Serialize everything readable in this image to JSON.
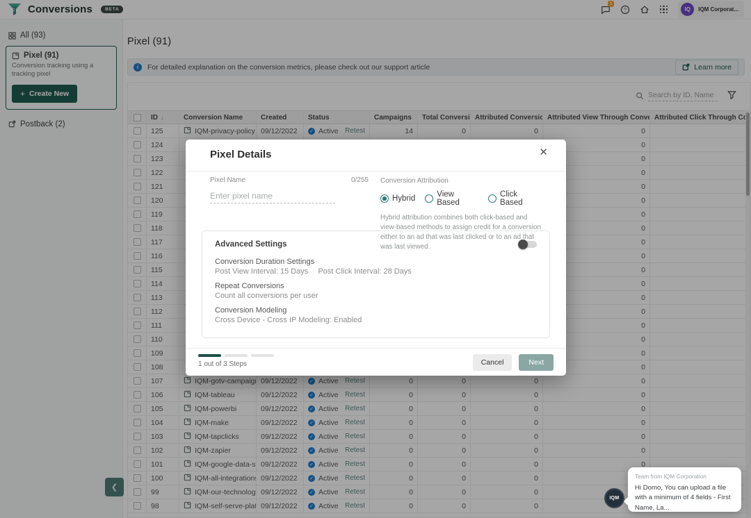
{
  "colors": {
    "accent_teal": "#1f5c52",
    "active_blue": "#1f7fd0",
    "avatar_purple": "#6d4bc4",
    "badge_orange": "#efa12d",
    "step_active": "#1d4f49"
  },
  "header": {
    "app_title": "Conversions",
    "beta_badge": "BETA",
    "notification_count": "1",
    "avatar_initials": "IQ",
    "account_name": "IQM Corporat..."
  },
  "sidebar": {
    "all_label": "All (93)",
    "pixel_card": {
      "title": "Pixel (91)",
      "description": "Conversion tracking using a tracking pixel",
      "create_label": "Create New",
      "plus": "+"
    },
    "postback_label": "Postback (2)"
  },
  "main": {
    "page_title": "Pixel (91)",
    "banner_text": "For detailed explanation on the conversion metrics, please check out our support article",
    "learn_more_label": "Learn more",
    "search_placeholder": "Search by ID, Name"
  },
  "table": {
    "columns": [
      "ID",
      "Conversion Name",
      "Created",
      "Status",
      "Campaigns",
      "Total Conversions",
      "Attributed Conversions",
      "Attributed View Through Conversions",
      "Attributed Click Through Conversions"
    ],
    "rows": [
      {
        "id": "125",
        "name": "IQM-privacy-policy",
        "created": "09/12/2022",
        "status": "Active",
        "action": "Retest",
        "campaigns": "14",
        "total": "0",
        "attributed": "0",
        "view_through": "0",
        "click_through": ""
      },
      {
        "id": "124",
        "name": "",
        "created": "",
        "status": "",
        "action": "",
        "campaigns": "",
        "total": "",
        "attributed": "",
        "view_through": "0",
        "click_through": ""
      },
      {
        "id": "123",
        "name": "",
        "created": "",
        "status": "",
        "action": "",
        "campaigns": "",
        "total": "",
        "attributed": "",
        "view_through": "0",
        "click_through": ""
      },
      {
        "id": "122",
        "name": "",
        "created": "",
        "status": "",
        "action": "",
        "campaigns": "",
        "total": "",
        "attributed": "",
        "view_through": "0",
        "click_through": ""
      },
      {
        "id": "121",
        "name": "",
        "created": "",
        "status": "",
        "action": "",
        "campaigns": "",
        "total": "",
        "attributed": "",
        "view_through": "0",
        "click_through": ""
      },
      {
        "id": "120",
        "name": "",
        "created": "",
        "status": "",
        "action": "",
        "campaigns": "",
        "total": "",
        "attributed": "",
        "view_through": "0",
        "click_through": ""
      },
      {
        "id": "119",
        "name": "",
        "created": "",
        "status": "",
        "action": "",
        "campaigns": "",
        "total": "",
        "attributed": "",
        "view_through": "0",
        "click_through": ""
      },
      {
        "id": "118",
        "name": "",
        "created": "",
        "status": "",
        "action": "",
        "campaigns": "",
        "total": "",
        "attributed": "",
        "view_through": "0",
        "click_through": ""
      },
      {
        "id": "117",
        "name": "",
        "created": "",
        "status": "",
        "action": "",
        "campaigns": "",
        "total": "",
        "attributed": "",
        "view_through": "0",
        "click_through": ""
      },
      {
        "id": "116",
        "name": "",
        "created": "",
        "status": "",
        "action": "",
        "campaigns": "",
        "total": "",
        "attributed": "",
        "view_through": "0",
        "click_through": ""
      },
      {
        "id": "115",
        "name": "",
        "created": "",
        "status": "",
        "action": "",
        "campaigns": "",
        "total": "",
        "attributed": "",
        "view_through": "0",
        "click_through": ""
      },
      {
        "id": "114",
        "name": "",
        "created": "",
        "status": "",
        "action": "",
        "campaigns": "",
        "total": "",
        "attributed": "",
        "view_through": "0",
        "click_through": ""
      },
      {
        "id": "113",
        "name": "",
        "created": "",
        "status": "",
        "action": "",
        "campaigns": "",
        "total": "",
        "attributed": "",
        "view_through": "0",
        "click_through": ""
      },
      {
        "id": "112",
        "name": "",
        "created": "",
        "status": "",
        "action": "",
        "campaigns": "",
        "total": "",
        "attributed": "",
        "view_through": "0",
        "click_through": ""
      },
      {
        "id": "111",
        "name": "",
        "created": "",
        "status": "",
        "action": "",
        "campaigns": "",
        "total": "",
        "attributed": "",
        "view_through": "0",
        "click_through": ""
      },
      {
        "id": "110",
        "name": "",
        "created": "",
        "status": "",
        "action": "",
        "campaigns": "",
        "total": "",
        "attributed": "",
        "view_through": "0",
        "click_through": ""
      },
      {
        "id": "109",
        "name": "",
        "created": "",
        "status": "",
        "action": "",
        "campaigns": "",
        "total": "",
        "attributed": "",
        "view_through": "0",
        "click_through": ""
      },
      {
        "id": "108",
        "name": "",
        "created": "",
        "status": "",
        "action": "",
        "campaigns": "",
        "total": "",
        "attributed": "",
        "view_through": "0",
        "click_through": ""
      },
      {
        "id": "107",
        "name": "IQM-gotv-campaigns",
        "created": "09/12/2022",
        "status": "Active",
        "action": "Retest",
        "campaigns": "0",
        "total": "0",
        "attributed": "0",
        "view_through": "0",
        "click_through": ""
      },
      {
        "id": "106",
        "name": "IQM-tableau",
        "created": "09/12/2022",
        "status": "Active",
        "action": "Retest",
        "campaigns": "0",
        "total": "0",
        "attributed": "0",
        "view_through": "0",
        "click_through": ""
      },
      {
        "id": "105",
        "name": "IQM-powerbi",
        "created": "09/12/2022",
        "status": "Active",
        "action": "Retest",
        "campaigns": "0",
        "total": "0",
        "attributed": "0",
        "view_through": "0",
        "click_through": ""
      },
      {
        "id": "104",
        "name": "IQM-make",
        "created": "09/12/2022",
        "status": "Active",
        "action": "Retest",
        "campaigns": "0",
        "total": "0",
        "attributed": "0",
        "view_through": "0",
        "click_through": ""
      },
      {
        "id": "103",
        "name": "IQM-tapclicks",
        "created": "09/12/2022",
        "status": "Active",
        "action": "Retest",
        "campaigns": "0",
        "total": "0",
        "attributed": "0",
        "view_through": "0",
        "click_through": ""
      },
      {
        "id": "102",
        "name": "IQM-zapier",
        "created": "09/12/2022",
        "status": "Active",
        "action": "Retest",
        "campaigns": "0",
        "total": "0",
        "attributed": "0",
        "view_through": "0",
        "click_through": ""
      },
      {
        "id": "101",
        "name": "IQM-google-data-stu...",
        "created": "09/12/2022",
        "status": "Active",
        "action": "Retest",
        "campaigns": "0",
        "total": "0",
        "attributed": "0",
        "view_through": "0",
        "click_through": ""
      },
      {
        "id": "100",
        "name": "IQM-all-integrations",
        "created": "09/12/2022",
        "status": "Active",
        "action": "Retest",
        "campaigns": "0",
        "total": "0",
        "attributed": "0",
        "view_through": "0",
        "click_through": ""
      },
      {
        "id": "99",
        "name": "IQM-our-technologies",
        "created": "09/12/2022",
        "status": "Active",
        "action": "Retest",
        "campaigns": "0",
        "total": "0",
        "attributed": "0",
        "view_through": "0",
        "click_through": ""
      },
      {
        "id": "98",
        "name": "IQM-self-serve-platfo...",
        "created": "09/12/2022",
        "status": "Active",
        "action": "Retest",
        "campaigns": "0",
        "total": "0",
        "attributed": "0",
        "view_through": "0",
        "click_through": ""
      }
    ]
  },
  "modal": {
    "title": "Pixel Details",
    "pixel_name_label": "Pixel Name",
    "char_counter": "0/255",
    "pixel_name_placeholder": "Enter pixel name",
    "attribution_label": "Conversion Attribution",
    "attribution_options": [
      "Hybrid",
      "View Based",
      "Click Based"
    ],
    "attribution_selected": "Hybrid",
    "attribution_description": "Hybrid attribution combines both click-based and view-based methods to assign credit for a conversion either to an ad that was last clicked or to an ad that was last viewed.",
    "advanced": {
      "title": "Advanced Settings",
      "duration_label": "Conversion Duration Settings",
      "post_view": "Post View Interval: 15 Days",
      "post_click": "Post Click Interval: 28 Days",
      "repeat_label": "Repeat Conversions",
      "repeat_value": "Count all conversions per user",
      "modeling_label": "Conversion Modeling",
      "modeling_value": "Cross Device - Cross IP Modeling: Enabled"
    },
    "steps_text": "1 out of 3 Steps",
    "cancel_label": "Cancel",
    "next_label": "Next"
  },
  "chat": {
    "avatar_text": "IQM",
    "from": "Team from IQM Corporation",
    "message": "Hi Domo, You can upload a file with a minimum of 4 fields - First Name, La..."
  }
}
